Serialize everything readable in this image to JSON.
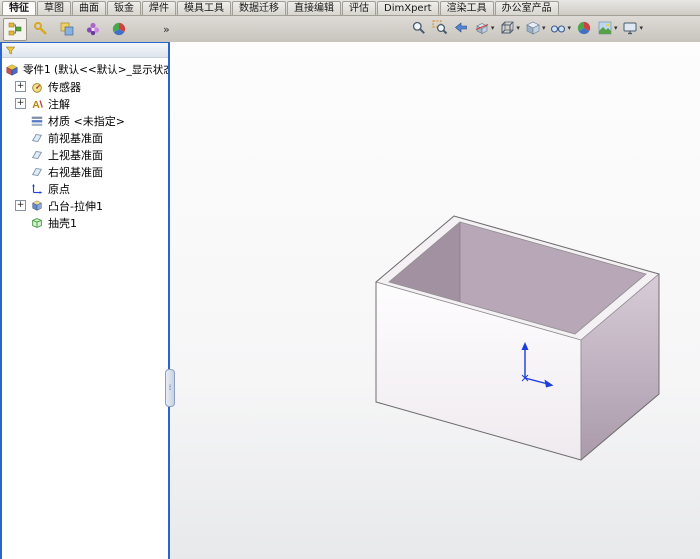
{
  "ribbon": {
    "tabs": [
      {
        "label": "特征",
        "active": true
      },
      {
        "label": "草图",
        "active": false
      },
      {
        "label": "曲面",
        "active": false
      },
      {
        "label": "钣金",
        "active": false
      },
      {
        "label": "焊件",
        "active": false
      },
      {
        "label": "模具工具",
        "active": false
      },
      {
        "label": "数据迁移",
        "active": false
      },
      {
        "label": "直接编辑",
        "active": false
      },
      {
        "label": "评估",
        "active": false
      },
      {
        "label": "DimXpert",
        "active": false
      },
      {
        "label": "渲染工具",
        "active": false
      },
      {
        "label": "办公室产品",
        "active": false
      }
    ]
  },
  "panel_tabs": {
    "overflow": "»",
    "buttons": [
      {
        "name": "featuremanager-tab",
        "icon": "pt_feature",
        "active": true
      },
      {
        "name": "propertymanager-tab",
        "icon": "pt_property",
        "active": false
      },
      {
        "name": "configurationmanager-tab",
        "icon": "pt_config",
        "active": false
      },
      {
        "name": "dimxpertmanager-tab",
        "icon": "pt_dimx",
        "active": false
      },
      {
        "name": "displaymanager-tab",
        "icon": "pt_display",
        "active": false
      }
    ]
  },
  "tree": {
    "root": {
      "label": "零件1 (默认<<默认>_显示状态",
      "icon": "part"
    },
    "items": [
      {
        "label": "传感器",
        "icon": "sensor",
        "expander": "+"
      },
      {
        "label": "注解",
        "icon": "annotation",
        "expander": "+"
      },
      {
        "label": "材质 <未指定>",
        "icon": "material"
      },
      {
        "label": "前视基准面",
        "icon": "plane"
      },
      {
        "label": "上视基准面",
        "icon": "plane"
      },
      {
        "label": "右视基准面",
        "icon": "plane"
      },
      {
        "label": "原点",
        "icon": "origin"
      },
      {
        "label": "凸台-拉伸1",
        "icon": "extrude",
        "expander": "+"
      },
      {
        "label": "抽壳1",
        "icon": "shell"
      }
    ]
  },
  "view_toolbar": {
    "buttons": [
      {
        "name": "zoom-to-fit",
        "icon": "v_zoomfit",
        "dropdown": false
      },
      {
        "name": "zoom-to-area",
        "icon": "v_zoomarea",
        "dropdown": false
      },
      {
        "name": "previous-view",
        "icon": "v_prevview",
        "dropdown": false
      },
      {
        "name": "section-view",
        "icon": "v_section",
        "dropdown": true
      },
      {
        "name": "view-orientation",
        "icon": "v_orientation",
        "dropdown": true
      },
      {
        "name": "display-style",
        "icon": "v_displaystyle",
        "dropdown": true
      },
      {
        "name": "hide-show-items",
        "icon": "v_hideshow",
        "dropdown": true
      },
      {
        "name": "edit-appearance",
        "icon": "v_appearance",
        "dropdown": false
      },
      {
        "name": "apply-scene",
        "icon": "v_scene",
        "dropdown": true
      },
      {
        "name": "view-settings",
        "icon": "v_settings",
        "dropdown": true
      }
    ]
  },
  "colors": {
    "accent_blue": "#2a66c9",
    "interior_purple": "#a191a1",
    "right_face_purple": "#b5a5b5",
    "origin_arrow_blue": "#1d3ed9"
  }
}
